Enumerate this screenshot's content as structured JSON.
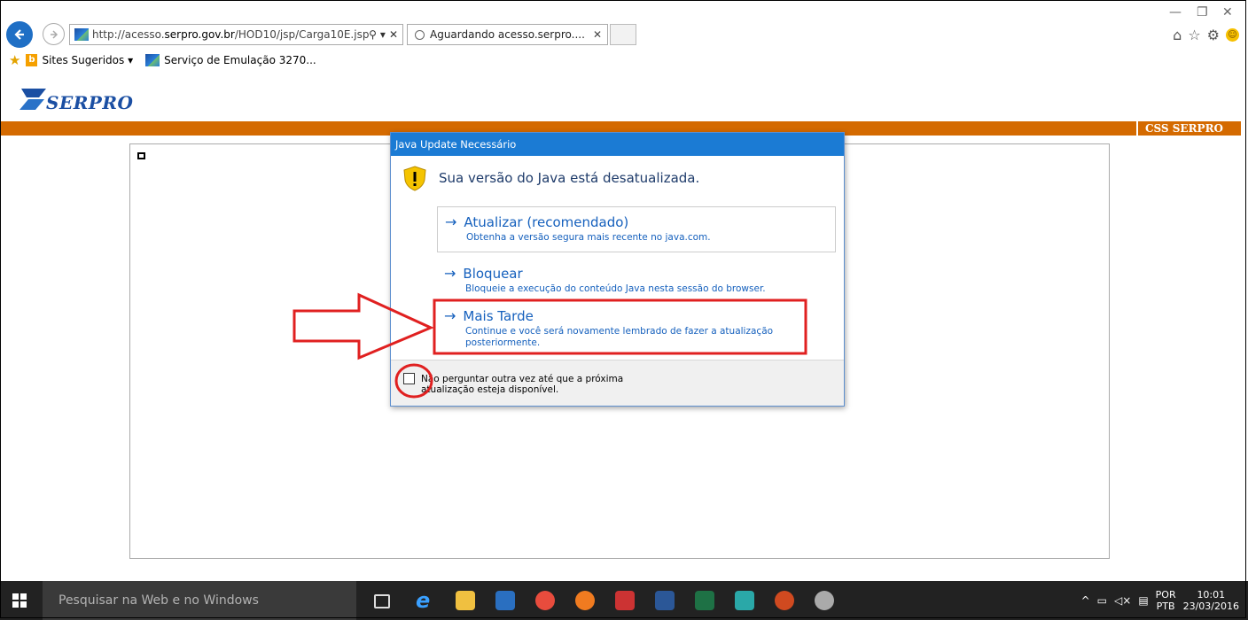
{
  "browser": {
    "address_url_prefix": "http://acesso.",
    "address_url_domain": "serpro.gov.br",
    "address_url_suffix": "/HOD10/jsp/Carga10E.jsp?l",
    "search_glyph": "⚲",
    "dropdown_glyph": "▾",
    "close_glyph": "✕",
    "tab_title": "Aguardando acesso.serpro....",
    "tab_close": "✕",
    "window_minimize": "—",
    "window_restore": "❐",
    "window_close": "✕",
    "favorites": {
      "sites_sugeridos": "Sites Sugeridos ▾",
      "servico_emulacao": "Serviço de Emulação 3270..."
    }
  },
  "page": {
    "logo_text": "SERPRO",
    "badge": "CSS SERPRO"
  },
  "dialog": {
    "title": "Java Update Necessário",
    "message": "Sua versão do Java está desatualizada.",
    "options": [
      {
        "title": "Atualizar (recomendado)",
        "desc": "Obtenha a versão segura mais recente no java.com."
      },
      {
        "title": "Bloquear",
        "desc": "Bloqueie a execução do conteúdo Java nesta sessão do browser."
      },
      {
        "title": "Mais Tarde",
        "desc": "Continue e você será novamente lembrado de fazer a atualização posteriormente."
      }
    ],
    "arrow_glyph": "→",
    "checkbox_label": "Não perguntar outra vez até que a próxima atualização esteja disponível."
  },
  "annotation_colors": {
    "highlight": "#e02020"
  },
  "taskbar": {
    "search_placeholder": "Pesquisar na Web e no Windows",
    "lang_top": "POR",
    "lang_bottom": "PTB",
    "time": "10:01",
    "date": "23/03/2016"
  }
}
